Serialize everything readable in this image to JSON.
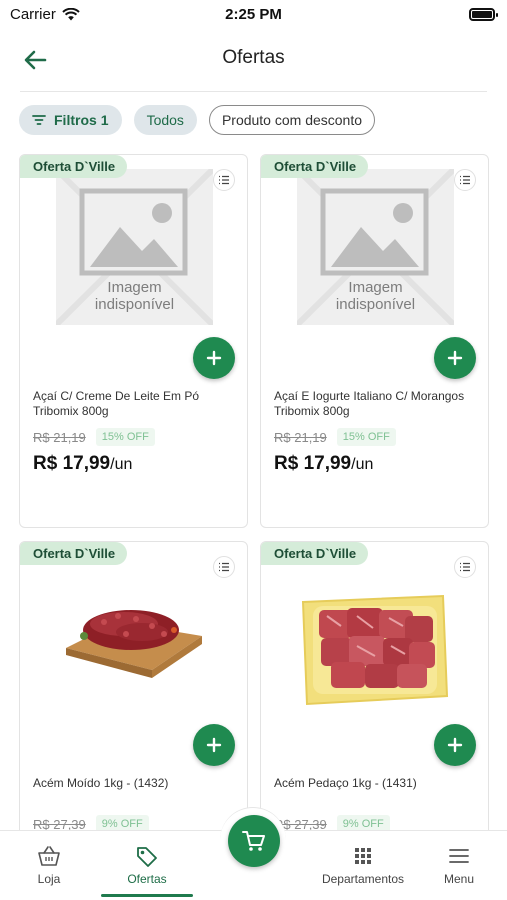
{
  "status_bar": {
    "carrier": "Carrier",
    "time": "2:25 PM"
  },
  "header": {
    "title": "Ofertas"
  },
  "filters": {
    "filter_label": "Filtros",
    "filter_count": "1",
    "all_label": "Todos",
    "discount_label": "Produto com desconto"
  },
  "products": [
    {
      "badge": "Oferta D`Ville",
      "image": "placeholder",
      "image_text_line1": "Imagem",
      "image_text_line2": "indisponível",
      "name": "Açaí C/ Creme De Leite Em Pó Tribomix 800g",
      "old_price": "R$ 21,19",
      "discount": "15% OFF",
      "price": "R$ 17,99",
      "unit": "/un"
    },
    {
      "badge": "Oferta D`Ville",
      "image": "placeholder",
      "image_text_line1": "Imagem",
      "image_text_line2": "indisponível",
      "name": "Açaí E Iogurte Italiano C/ Morangos Tribomix 800g",
      "old_price": "R$ 21,19",
      "discount": "15% OFF",
      "price": "R$ 17,99",
      "unit": "/un"
    },
    {
      "badge": "Oferta D`Ville",
      "image": "ground-beef",
      "name": "Acém Moído 1kg - (1432)",
      "old_price": "R$ 27,39",
      "discount": "9% OFF",
      "price": "",
      "unit": ""
    },
    {
      "badge": "Oferta D`Ville",
      "image": "beef-cubes",
      "name": "Acém Pedaço 1kg - (1431)",
      "old_price": "R$ 27,39",
      "discount": "9% OFF",
      "price": "",
      "unit": ""
    }
  ],
  "bottom_nav": {
    "tabs": [
      {
        "label": "Loja",
        "icon": "basket-icon"
      },
      {
        "label": "Ofertas",
        "icon": "tag-icon",
        "active": true
      },
      {
        "label": "Departamentos",
        "icon": "grid-icon"
      },
      {
        "label": "Menu",
        "icon": "menu-icon"
      }
    ],
    "cart_icon": "cart-icon"
  },
  "colors": {
    "brand_green": "#1f8a50",
    "badge_bg": "#d5ecd9",
    "chip_bg": "#dfe6ea"
  }
}
